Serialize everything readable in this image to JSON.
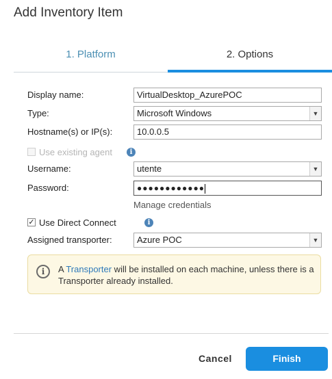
{
  "dialog": {
    "title": "Add Inventory Item"
  },
  "tabs": [
    {
      "label": "1. Platform",
      "active": false
    },
    {
      "label": "2. Options",
      "active": true
    }
  ],
  "form": {
    "display_name": {
      "label": "Display name:",
      "value": "VirtualDesktop_AzurePOC"
    },
    "type": {
      "label": "Type:",
      "value": "Microsoft Windows"
    },
    "hostname": {
      "label": "Hostname(s) or IP(s):",
      "value": "10.0.0.5"
    },
    "use_existing_agent": {
      "label": "Use existing agent",
      "checked": false,
      "disabled": true
    },
    "username": {
      "label": "Username:",
      "value": "utente"
    },
    "password": {
      "label": "Password:",
      "masked_value": "●●●●●●●●●●●●"
    },
    "manage_credentials": "Manage credentials",
    "use_direct_connect": {
      "label": "Use Direct Connect",
      "checked": true
    },
    "assigned_transporter": {
      "label": "Assigned transporter:",
      "value": "Azure POC"
    }
  },
  "alert": {
    "prefix": "A ",
    "link": "Transporter",
    "suffix": " will be installed on each machine, unless there is a Transporter already installed."
  },
  "buttons": {
    "cancel": "Cancel",
    "finish": "Finish"
  },
  "colors": {
    "accent": "#1a8ee0",
    "tab_inactive": "#4b8fb3",
    "alert_bg": "#fdf8e4",
    "info_icon": "#4d84b8"
  }
}
